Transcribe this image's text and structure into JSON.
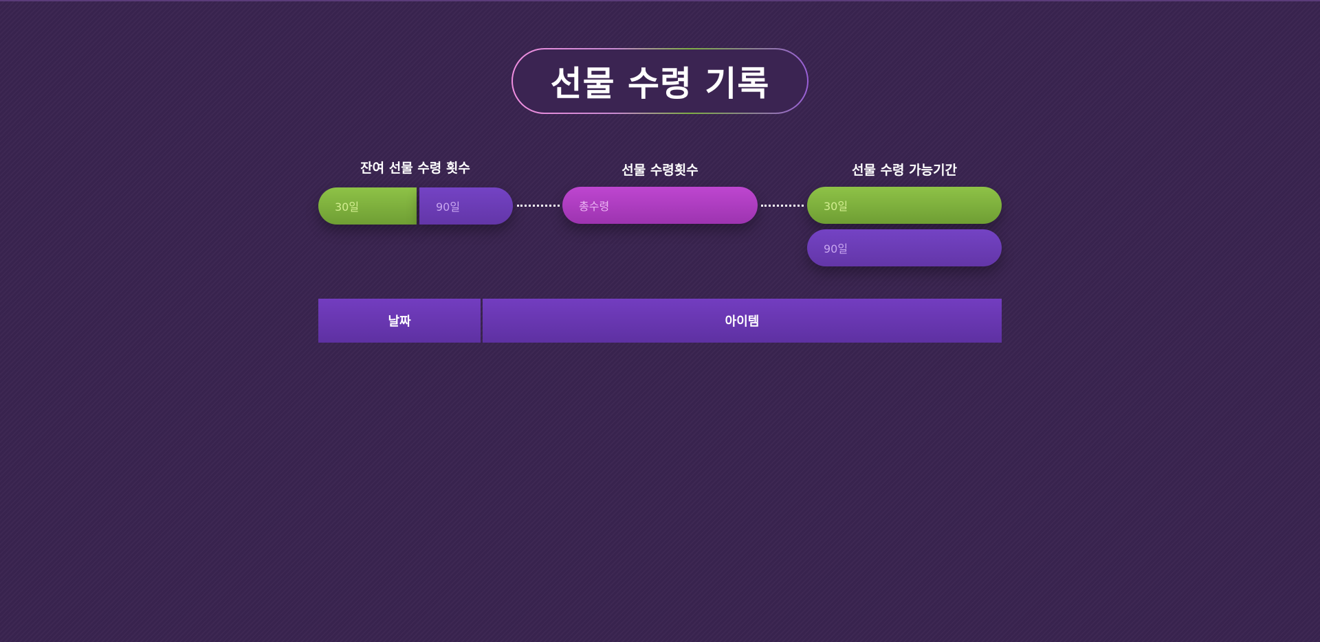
{
  "title": "선물 수령 기록",
  "remaining": {
    "label": "잔여 선물 수령 횟수",
    "days_30": "30일",
    "days_90": "90일"
  },
  "count": {
    "label": "선물 수령횟수",
    "total": "총수령"
  },
  "period": {
    "label": "선물 수령 가능기간",
    "days_30": "30일",
    "days_90": "90일"
  },
  "table": {
    "columns": [
      "날짜",
      "아이템"
    ]
  },
  "colors": {
    "background": "#3a2450",
    "green": "#7fae3c",
    "purple": "#6a3bb6",
    "magenta": "#b03fc4"
  }
}
